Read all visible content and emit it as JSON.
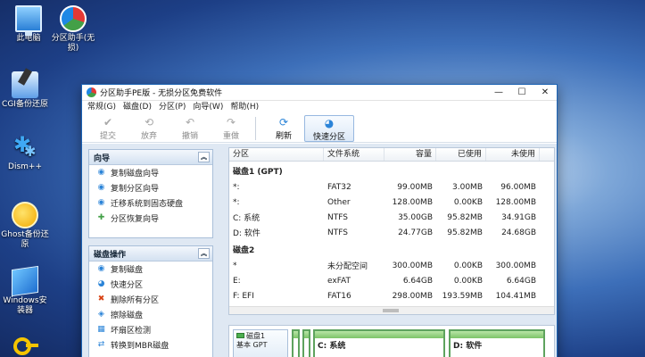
{
  "desktop": {
    "icons": [
      {
        "label": "此电脑",
        "icon": "computer-icon"
      },
      {
        "label": "分区助手(无损)",
        "icon": "partition-assistant-icon"
      },
      {
        "label": "CGI备份还原",
        "icon": "cgi-backup-icon"
      },
      {
        "label": "Dism++",
        "icon": "dism-icon"
      },
      {
        "label": "Ghost备份还原",
        "icon": "ghost-icon"
      },
      {
        "label": "Windows安装器",
        "icon": "windows-installer-icon"
      },
      {
        "label": "",
        "icon": "key-icon"
      }
    ]
  },
  "window": {
    "title": "分区助手PE版 - 无损分区免费软件",
    "controls": {
      "minimize": "—",
      "maximize": "☐",
      "close": "✕"
    },
    "menu": [
      "常规(G)",
      "磁盘(D)",
      "分区(P)",
      "向导(W)",
      "帮助(H)"
    ],
    "toolbar": [
      {
        "label": "提交",
        "icon": "commit-icon",
        "enabled": false
      },
      {
        "label": "放弃",
        "icon": "discard-icon",
        "enabled": false
      },
      {
        "label": "撤销",
        "icon": "undo-icon",
        "enabled": false
      },
      {
        "label": "重做",
        "icon": "redo-icon",
        "enabled": false
      },
      {
        "label": "刷新",
        "icon": "refresh-icon",
        "enabled": true
      },
      {
        "label": "快速分区",
        "icon": "quick-partition-icon",
        "enabled": true
      }
    ]
  },
  "wizard_panel": {
    "title": "向导",
    "collapse": "︽",
    "items": [
      "复制磁盘向导",
      "复制分区向导",
      "迁移系统到固态硬盘",
      "分区恢复向导"
    ]
  },
  "disk_ops_panel": {
    "title": "磁盘操作",
    "collapse": "︽",
    "items": [
      "复制磁盘",
      "快速分区",
      "删除所有分区",
      "擦除磁盘",
      "坏扇区检测",
      "转换到MBR磁盘"
    ]
  },
  "table": {
    "columns": [
      "分区",
      "文件系统",
      "容量",
      "已使用",
      "未使用"
    ],
    "disks": [
      {
        "name": "磁盘1 (GPT)",
        "rows": [
          [
            "*:",
            "FAT32",
            "99.00MB",
            "3.00MB",
            "96.00MB"
          ],
          [
            "*:",
            "Other",
            "128.00MB",
            "0.00KB",
            "128.00MB"
          ],
          [
            "C: 系统",
            "NTFS",
            "35.00GB",
            "95.82MB",
            "34.91GB"
          ],
          [
            "D: 软件",
            "NTFS",
            "24.77GB",
            "95.82MB",
            "24.68GB"
          ]
        ]
      },
      {
        "name": "磁盘2",
        "rows": [
          [
            "*",
            "未分配空间",
            "300.00MB",
            "0.00KB",
            "300.00MB"
          ],
          [
            "E:",
            "exFAT",
            "6.64GB",
            "0.00KB",
            "6.64GB"
          ],
          [
            "F: EFI",
            "FAT16",
            "298.00MB",
            "193.59MB",
            "104.41MB"
          ]
        ]
      }
    ]
  },
  "disk_map": {
    "disk_label": "磁盘1",
    "disk_sub": "基本 GPT",
    "partitions": [
      "",
      "",
      "C: 系统",
      "D: 软件"
    ]
  },
  "colors": {
    "accent": "#2b84d8",
    "partition_bar": "#7cc468",
    "window_border": "#1b62b3"
  }
}
